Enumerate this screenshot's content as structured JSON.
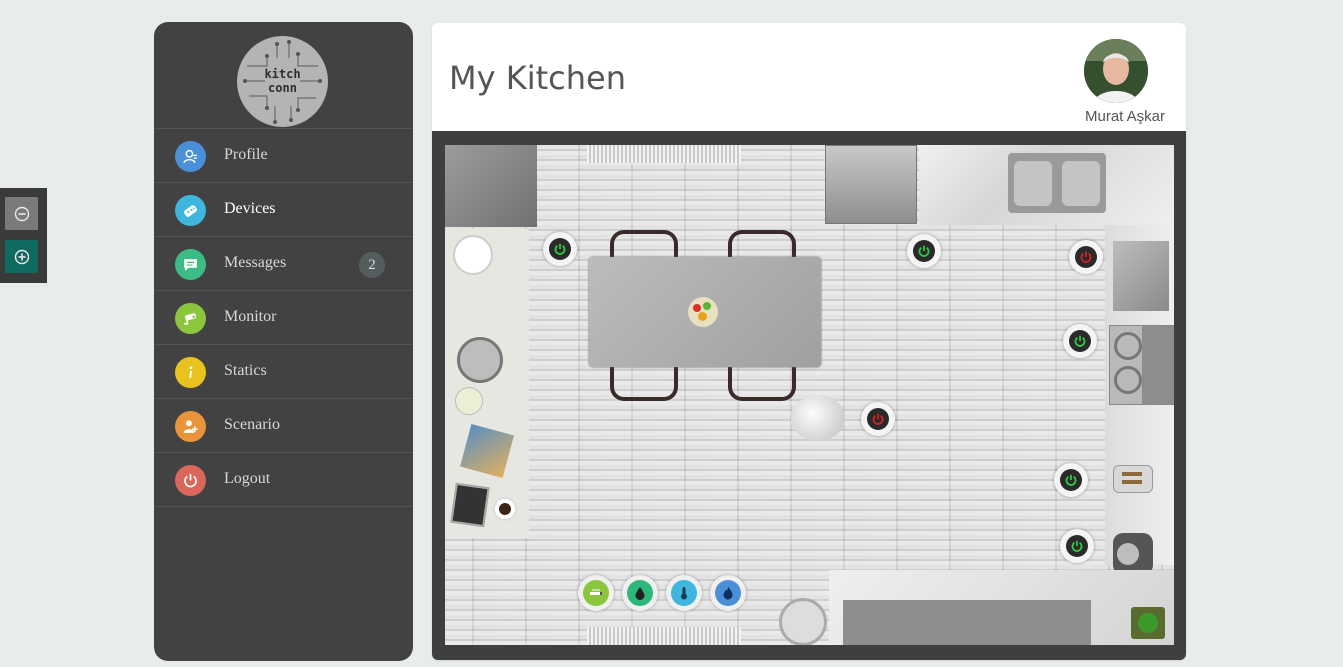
{
  "app": {
    "logo_text_line1": "kitch",
    "logo_text_line2": "conn"
  },
  "zoom": {
    "out_icon": "minus-circle-icon",
    "in_icon": "plus-circle-icon"
  },
  "sidebar": {
    "items": [
      {
        "label": "Profile",
        "icon": "profile-icon",
        "color": "#4a90d9"
      },
      {
        "label": "Devices",
        "icon": "remote-control-icon",
        "color": "#3fb6dd"
      },
      {
        "label": "Messages",
        "icon": "chat-icon",
        "color": "#3dbb85",
        "badge": "2"
      },
      {
        "label": "Monitor",
        "icon": "camera-icon",
        "color": "#8cc63f"
      },
      {
        "label": "Statics",
        "icon": "info-icon",
        "color": "#e8c21e"
      },
      {
        "label": "Scenario",
        "icon": "user-add-icon",
        "color": "#e8943a"
      },
      {
        "label": "Logout",
        "icon": "power-icon",
        "color": "#d9685a"
      }
    ],
    "active": "Devices"
  },
  "header": {
    "title": "My Kitchen",
    "user_name": "Murat Aşkar"
  },
  "devices": {
    "power_on_color": "#2ecc40",
    "power_off_color": "#e02020",
    "switches": [
      {
        "name": "switch-top-left",
        "state": "on"
      },
      {
        "name": "switch-top-middle",
        "state": "on"
      },
      {
        "name": "switch-top-right",
        "state": "off"
      },
      {
        "name": "switch-stove",
        "state": "on"
      },
      {
        "name": "switch-center-lamp",
        "state": "off"
      },
      {
        "name": "switch-toaster",
        "state": "on"
      },
      {
        "name": "switch-mixer",
        "state": "on"
      }
    ],
    "sensors": [
      {
        "name": "smoke-sensor",
        "icon": "cigarette-icon",
        "color": "#8cc63f"
      },
      {
        "name": "water-sensor",
        "icon": "drop-icon",
        "color": "#2fb67c"
      },
      {
        "name": "temperature-sensor",
        "icon": "thermometer-icon",
        "color": "#3fb6dd"
      },
      {
        "name": "gas-sensor",
        "icon": "flame-icon",
        "color": "#4a90d9"
      }
    ]
  }
}
